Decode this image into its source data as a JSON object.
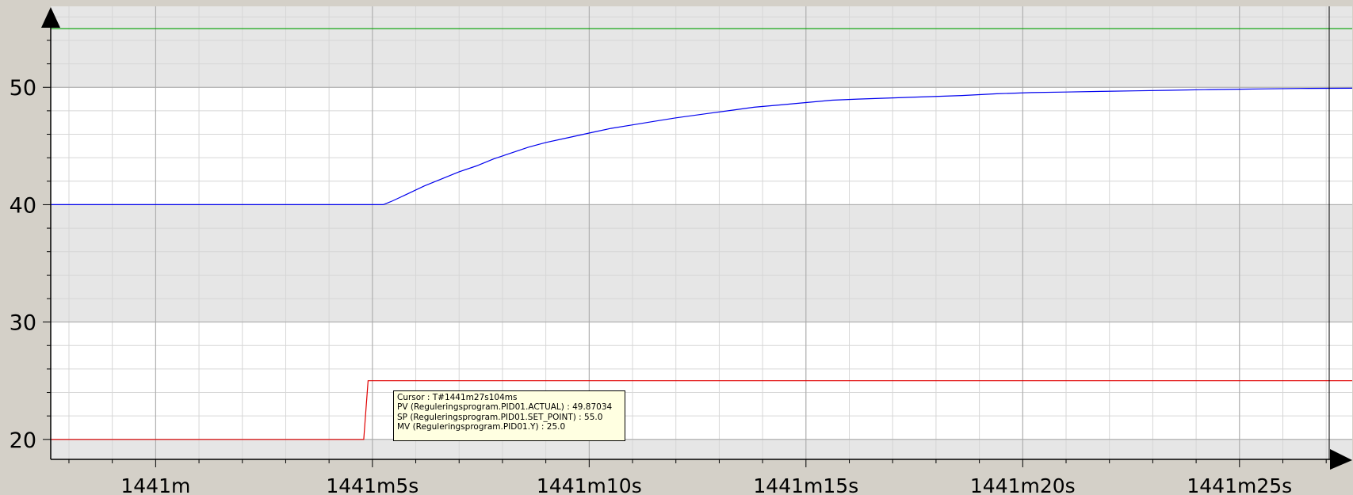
{
  "chart_data": {
    "type": "line",
    "title": "",
    "xlabel": "",
    "ylabel": "",
    "x_unit": "seconds",
    "x_ticks": [
      {
        "t": 0,
        "label": "1441m"
      },
      {
        "t": 5,
        "label": "1441m5s"
      },
      {
        "t": 10,
        "label": "1441m10s"
      },
      {
        "t": 15,
        "label": "1441m15s"
      },
      {
        "t": 20,
        "label": "1441m20s"
      },
      {
        "t": 25,
        "label": "1441m25s"
      }
    ],
    "y_ticks": [
      20,
      30,
      40,
      50
    ],
    "xlim": [
      -2.42,
      27.6
    ],
    "ylim": [
      18.3,
      56.9
    ],
    "grid": true,
    "series": [
      {
        "name": "SP",
        "color": "#00a000",
        "x": [
          -2.42,
          27.6
        ],
        "y": [
          55.0,
          55.0
        ]
      },
      {
        "name": "MV",
        "color": "#e00000",
        "x": [
          -2.42,
          4.8,
          4.9,
          27.6
        ],
        "y": [
          20.0,
          20.0,
          25.0,
          25.0
        ]
      },
      {
        "name": "PV",
        "color": "#0000ee",
        "x": [
          -2.42,
          5.25,
          5.45,
          5.8,
          6.2,
          6.6,
          7.0,
          7.4,
          7.8,
          8.2,
          8.6,
          9.0,
          9.5,
          10.0,
          10.5,
          11.0,
          11.5,
          12.0,
          12.6,
          13.2,
          13.8,
          14.4,
          15.0,
          15.6,
          16.2,
          17.0,
          17.8,
          18.6,
          19.4,
          20.2,
          21.0,
          21.8,
          22.6,
          23.4,
          24.2,
          25.0,
          25.6,
          26.4,
          27.6
        ],
        "y": [
          40.0,
          40.0,
          40.3,
          40.9,
          41.6,
          42.2,
          42.8,
          43.3,
          43.9,
          44.4,
          44.9,
          45.3,
          45.7,
          46.1,
          46.5,
          46.8,
          47.1,
          47.4,
          47.7,
          48.0,
          48.3,
          48.5,
          48.7,
          48.9,
          49.0,
          49.1,
          49.2,
          49.3,
          49.45,
          49.55,
          49.6,
          49.65,
          49.7,
          49.75,
          49.8,
          49.84,
          49.87,
          49.9,
          49.92
        ]
      }
    ]
  },
  "tooltip": {
    "lines": [
      "Cursor : T#1441m27s104ms",
      "PV (Reguleringsprogram.PID01.ACTUAL) : 49.87034",
      "SP (Reguleringsprogram.PID01.SET_POINT) : 55.0",
      "MV (Reguleringsprogram.PID01.Y) : 25.0"
    ]
  },
  "colors": {
    "background": "#d4d0c8",
    "band_light": "#ffffff",
    "band_dark": "#e6e6e6",
    "grid_major": "#a8a8a8",
    "grid_minor": "#d6d6d6",
    "tooltip_bg": "#ffffe1"
  }
}
